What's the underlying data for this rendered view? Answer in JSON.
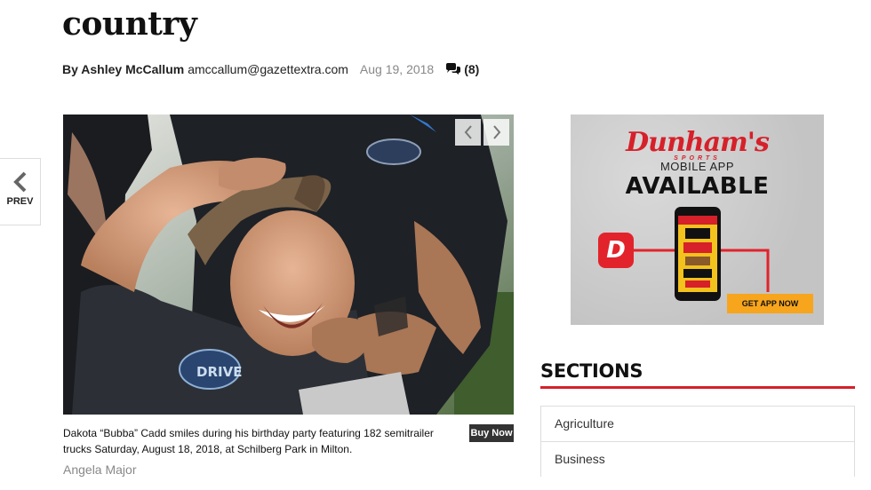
{
  "article": {
    "title": "country",
    "byline": {
      "author": "By Ashley McCallum",
      "email": "amccallum@gazettextra.com",
      "date": "Aug 19, 2018",
      "comment_count": "(8)"
    }
  },
  "gallery": {
    "prev_label": "PREV",
    "caption": "Dakota “Bubba” Cadd smiles during his birthday party featuring 182 semitrailer trucks Saturday, August 18, 2018, at Schilberg Park in Milton.",
    "buy_now_label": "Buy Now",
    "photo_credit": "Angela Major",
    "shirt_patch_text": "DRIVE"
  },
  "ad": {
    "brand": "Dunham's",
    "brand_sub": "SPORTS",
    "line1": "MOBILE APP",
    "line2": "AVAILABLE",
    "logo_letter": "D",
    "cta": "GET APP NOW",
    "colors": {
      "brand_red": "#d6202a",
      "cta_orange": "#f7a51d"
    }
  },
  "sidebar": {
    "sections_title": "SECTIONS",
    "items": [
      {
        "label": "Agriculture"
      },
      {
        "label": "Business"
      }
    ]
  },
  "colors": {
    "accent_red": "#d6202a",
    "muted_gray": "#888888"
  }
}
